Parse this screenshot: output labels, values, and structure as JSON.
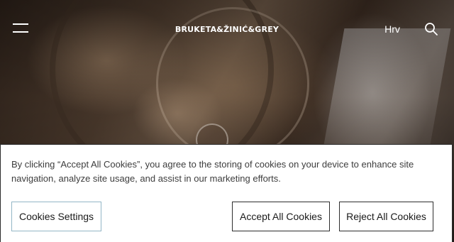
{
  "header": {
    "logo_text": "BRUKETA&ŽINIĆ&GREY",
    "language_label": "Hrv",
    "menu_icon": "hamburger-menu-icon",
    "search_icon": "search-icon",
    "text_color": "#ffffff"
  },
  "hero": {
    "media": "background photograph (video still)"
  },
  "cookie_banner": {
    "message": "By clicking “Accept All Cookies”, you agree to the storing of cookies on your device to enhance site navigation, analyze site usage, and assist in our marketing efforts.",
    "settings_label": "Cookies Settings",
    "accept_label": "Accept All Cookies",
    "reject_label": "Reject All Cookies",
    "background": "#ffffff",
    "settings_border_color": "#93b6c6"
  }
}
